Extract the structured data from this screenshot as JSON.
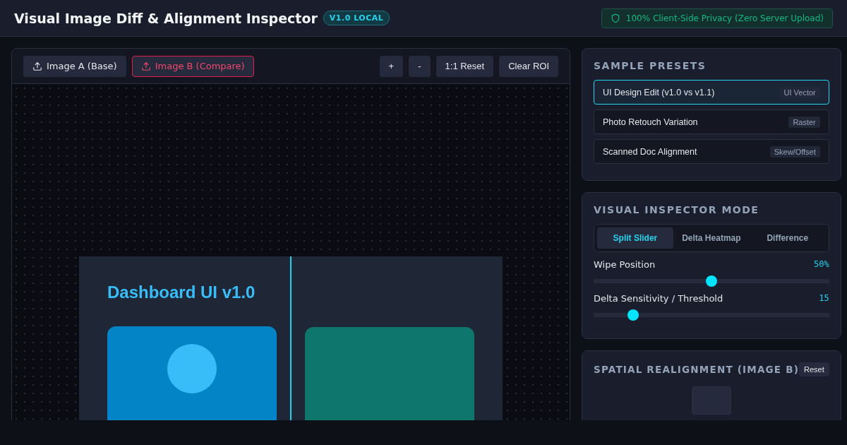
{
  "header": {
    "title": "Visual Image Diff & Alignment Inspector",
    "badge": "V1.0 LOCAL",
    "privacy": "100% Client-Side Privacy (Zero Server Upload)"
  },
  "toolbar": {
    "uploads": [
      {
        "label": "Image A (Base)",
        "kind": "base"
      },
      {
        "label": "Image B (Compare)",
        "kind": "compare"
      }
    ],
    "buttons": [
      "+",
      "-",
      "1:1 Reset",
      "Clear ROI"
    ]
  },
  "canvas": {
    "heading": "Dashboard UI v1.0",
    "wipe": {
      "level": 0.5
    }
  },
  "presets": {
    "title": "SAMPLE PRESETS",
    "items": [
      {
        "label": "UI Design Edit (v1.0 vs v1.1)",
        "tag": "UI Vector",
        "selected": true
      },
      {
        "label": "Photo Retouch Variation",
        "tag": "Raster",
        "selected": false
      },
      {
        "label": "Scanned Doc Alignment",
        "tag": "Skew/Offset",
        "selected": false
      }
    ]
  },
  "mode": {
    "title": "VISUAL INSPECTOR MODE",
    "tabs": [
      {
        "label": "Split Slider",
        "selected": true
      },
      {
        "label": "Delta Heatmap",
        "selected": false
      },
      {
        "label": "Difference",
        "selected": false
      }
    ],
    "sliders": [
      {
        "label": "Wipe Position",
        "reading": "50%",
        "level": 0.5
      },
      {
        "label": "Delta Sensitivity / Threshold",
        "reading": "15",
        "level": 0.15
      }
    ]
  },
  "realign": {
    "title": "SPATIAL REALIGNMENT (IMAGE B)",
    "reset": "Reset"
  }
}
